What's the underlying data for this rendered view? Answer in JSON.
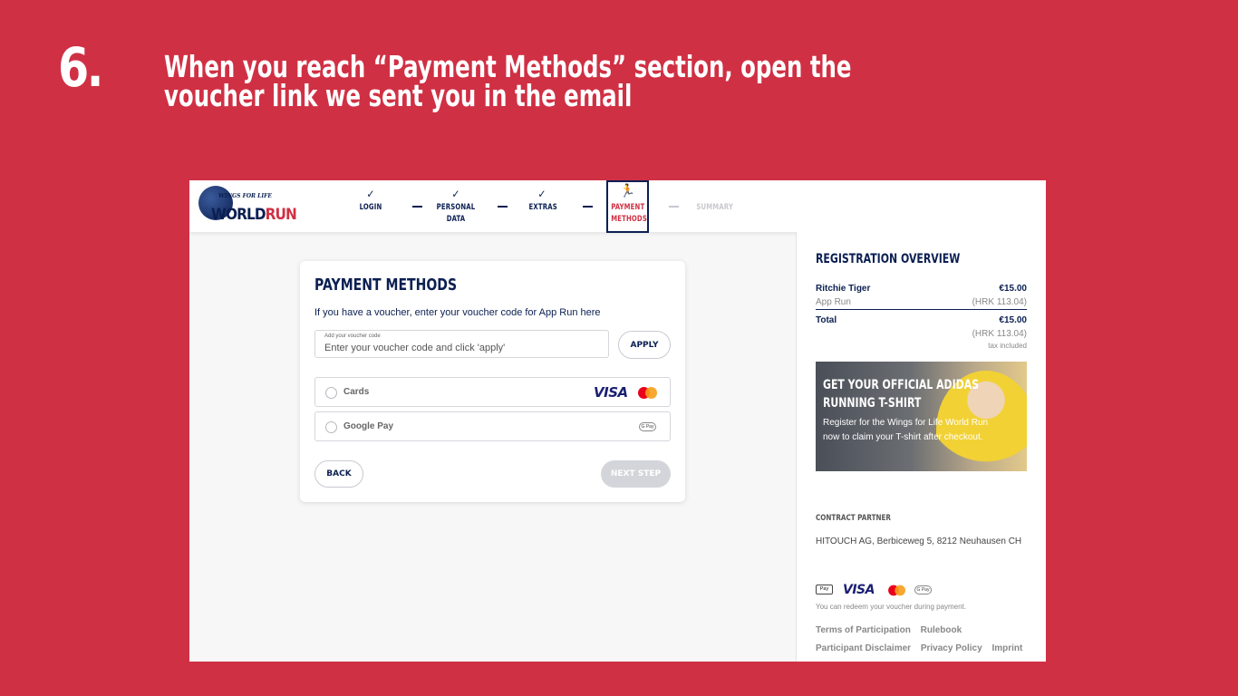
{
  "slide": {
    "step_number": "6.",
    "instruction": "When you reach “Payment Methods” section, open the voucher link we sent you in the email"
  },
  "brand": {
    "logo_top": "WINGS FOR LIFE",
    "logo_main": "WORLD",
    "logo_accent": "RUN"
  },
  "steps": [
    {
      "label": "LOGIN",
      "state": "done"
    },
    {
      "label": "PERSONAL DATA",
      "state": "done"
    },
    {
      "label": "EXTRAS",
      "state": "done"
    },
    {
      "label": "PAYMENT METHODS",
      "state": "active"
    },
    {
      "label": "SUMMARY",
      "state": "disabled"
    }
  ],
  "payment": {
    "title": "PAYMENT METHODS",
    "subtitle": "If you have a voucher, enter your voucher code for App Run here",
    "voucher_label": "Add your voucher code",
    "voucher_placeholder": "Enter your voucher code and click 'apply'",
    "voucher_value": "",
    "apply_label": "APPLY",
    "options": [
      {
        "label": "Cards",
        "selected": false
      },
      {
        "label": "Google Pay",
        "selected": false
      }
    ],
    "visa_label": "VISA",
    "gpay_label": "G Pay",
    "back_label": "BACK",
    "next_label": "NEXT STEP"
  },
  "overview": {
    "title": "REGISTRATION OVERVIEW",
    "name": "Ritchie Tiger",
    "name_price": "€15.00",
    "product": "App Run",
    "product_price": "(HRK 113.04)",
    "total_label": "Total",
    "total_price": "€15.00",
    "total_hrk": "(HRK 113.04)",
    "tax_note": "tax included"
  },
  "promo": {
    "title": "GET YOUR OFFICIAL ADIDAS RUNNING T-SHIRT",
    "text": "Register for the Wings for Life World Run now to claim your T-shirt after checkout."
  },
  "contract": {
    "title": "CONTRACT PARTNER",
    "text": "HITOUCH AG, Berbiceweg 5, 8212 Neuhausen CH"
  },
  "footer": {
    "applepay_label": "Pay",
    "visa_label": "VISA",
    "gpay_label": "G Pay",
    "note": "You can redeem your voucher during payment.",
    "links_row1": [
      "Terms of Participation",
      "Rulebook"
    ],
    "links_row2": [
      "Participant Disclaimer",
      "Privacy Policy",
      "Imprint"
    ]
  },
  "colors": {
    "brand_navy": "#0b1f52",
    "brand_red": "#d03044",
    "background": "#d03044"
  }
}
